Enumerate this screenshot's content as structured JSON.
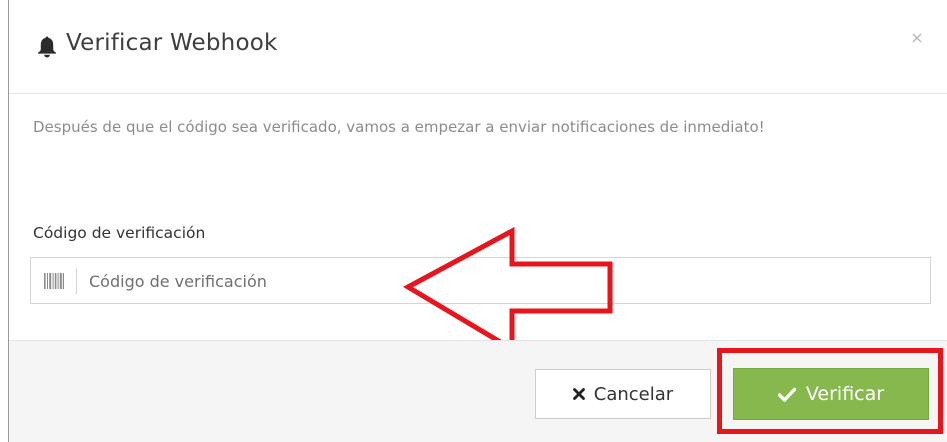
{
  "dialog": {
    "title": "Verificar Webhook",
    "description": "Después de que el código sea verificado, vamos a empezar a enviar notificaciones de inmediato!",
    "field_label": "Código de verificación",
    "input_placeholder": "Código de verificación",
    "input_value": ""
  },
  "footer": {
    "cancel_label": "Cancelar",
    "verify_label": "Verificar"
  },
  "icons": {
    "header": "bell-icon",
    "close": "close-icon",
    "input_addon": "barcode-icon",
    "cancel": "x-icon",
    "verify": "check-icon"
  },
  "colors": {
    "title_text": "#3e3e3e",
    "description_text": "#8c8c8c",
    "footer_bg": "#f5f5f5",
    "verify_button": "#87b84e",
    "annotation_red": "#e8151c"
  }
}
